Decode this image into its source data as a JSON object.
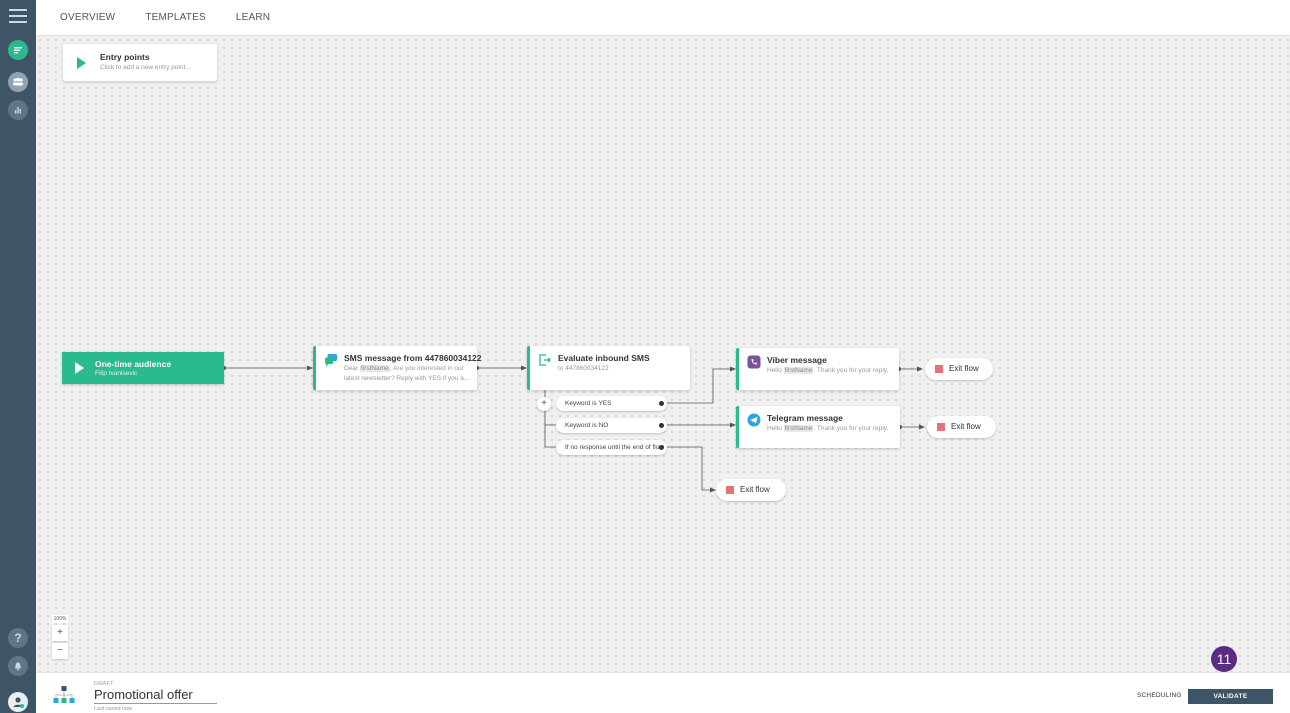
{
  "nav": {
    "tabs": [
      {
        "label": "OVERVIEW"
      },
      {
        "label": "TEMPLATES"
      },
      {
        "label": "LEARN"
      }
    ]
  },
  "sidebar": {
    "icons": [
      "menu-icon",
      "flows-icon",
      "people-icon",
      "analytics-icon",
      "help-icon",
      "bell-icon",
      "avatar-icon"
    ],
    "help_glyph": "?"
  },
  "entry_points": {
    "title": "Entry points",
    "subtitle": "Click to add a new entry point..."
  },
  "audience": {
    "title": "One-time audience",
    "subtitle": "Filip Ivanisevic"
  },
  "sms_node": {
    "title": "SMS message from 447860034122",
    "line1_pre": "Dear ",
    "line1_var": "firstName",
    "line1_post": ", Are you interested in our",
    "line2": "latest newsletter? Reply with YES if you a..."
  },
  "evaluate_node": {
    "title": "Evaluate inbound SMS",
    "subtitle": "to 447860034122"
  },
  "branches": {
    "plus": "+",
    "items": [
      {
        "label": "Keyword is YES"
      },
      {
        "label": "Keyword is NO"
      },
      {
        "label": "If no response until the end of flow"
      }
    ]
  },
  "viber_node": {
    "title": "Viber message",
    "text_pre": "Hello ",
    "text_var": "firstName",
    "text_post": ". Thank you for your reply."
  },
  "telegram_node": {
    "title": "Telegram message",
    "text_pre": "Hello ",
    "text_var": "firstName",
    "text_post": ". Thank you for your reply."
  },
  "exits": {
    "label": "Exit flow"
  },
  "zoom": {
    "level": "100%",
    "plus": "+",
    "minus": "−"
  },
  "footer": {
    "status": "DRAFT",
    "title": "Promotional offer",
    "saved": "Last saved now",
    "scheduling": "SCHEDULING",
    "validate": "VALIDATE"
  },
  "badge": {
    "value": "11"
  },
  "colors": {
    "accent": "#2bb98e",
    "rail": "#3e5568",
    "exit": "#e57373",
    "badge": "#5b2d82",
    "viber": "#7b519d",
    "telegram": "#2ca5e0"
  }
}
